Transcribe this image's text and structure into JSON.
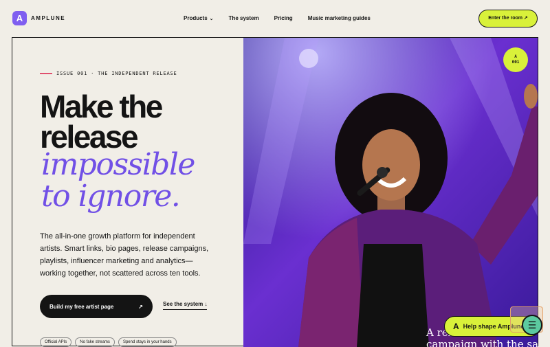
{
  "brand": {
    "logo_letter": "A",
    "name": "AMPLUNE",
    "accent": "#7f5ef0",
    "highlight": "#d9f13a"
  },
  "nav": {
    "items": [
      {
        "label": "Products",
        "has_dropdown": true
      },
      {
        "label": "The system"
      },
      {
        "label": "Pricing"
      },
      {
        "label": "Music marketing guides"
      }
    ],
    "cta_label": "Enter the room ↗"
  },
  "hero": {
    "issue_label": "ISSUE 001 · THE INDEPENDENT RELEASE",
    "headline_line1": "Make the",
    "headline_line2": "release",
    "headline_italic_line1": "impossible",
    "headline_italic_line2": "to ignore.",
    "description": "The all-in-one growth platform for independent artists. Smart links, bio pages, release campaigns, playlists, influencer marketing and analytics—working together, not scattered across ten tools.",
    "primary_button_label": "Build my free artist page",
    "primary_button_icon": "↗",
    "secondary_link_label": "See the system ↓",
    "pills": [
      "Official APIs",
      "No fake streams",
      "Spend stays in your hands"
    ],
    "badge_line1": "A",
    "badge_line2": "001",
    "image_caption_line1": "A rel",
    "image_caption_line2": "campaign with the same"
  },
  "help_widget": {
    "label": "Help shape Amplune",
    "logo_letter": "A"
  },
  "chat": {
    "icon": "chat-icon"
  }
}
